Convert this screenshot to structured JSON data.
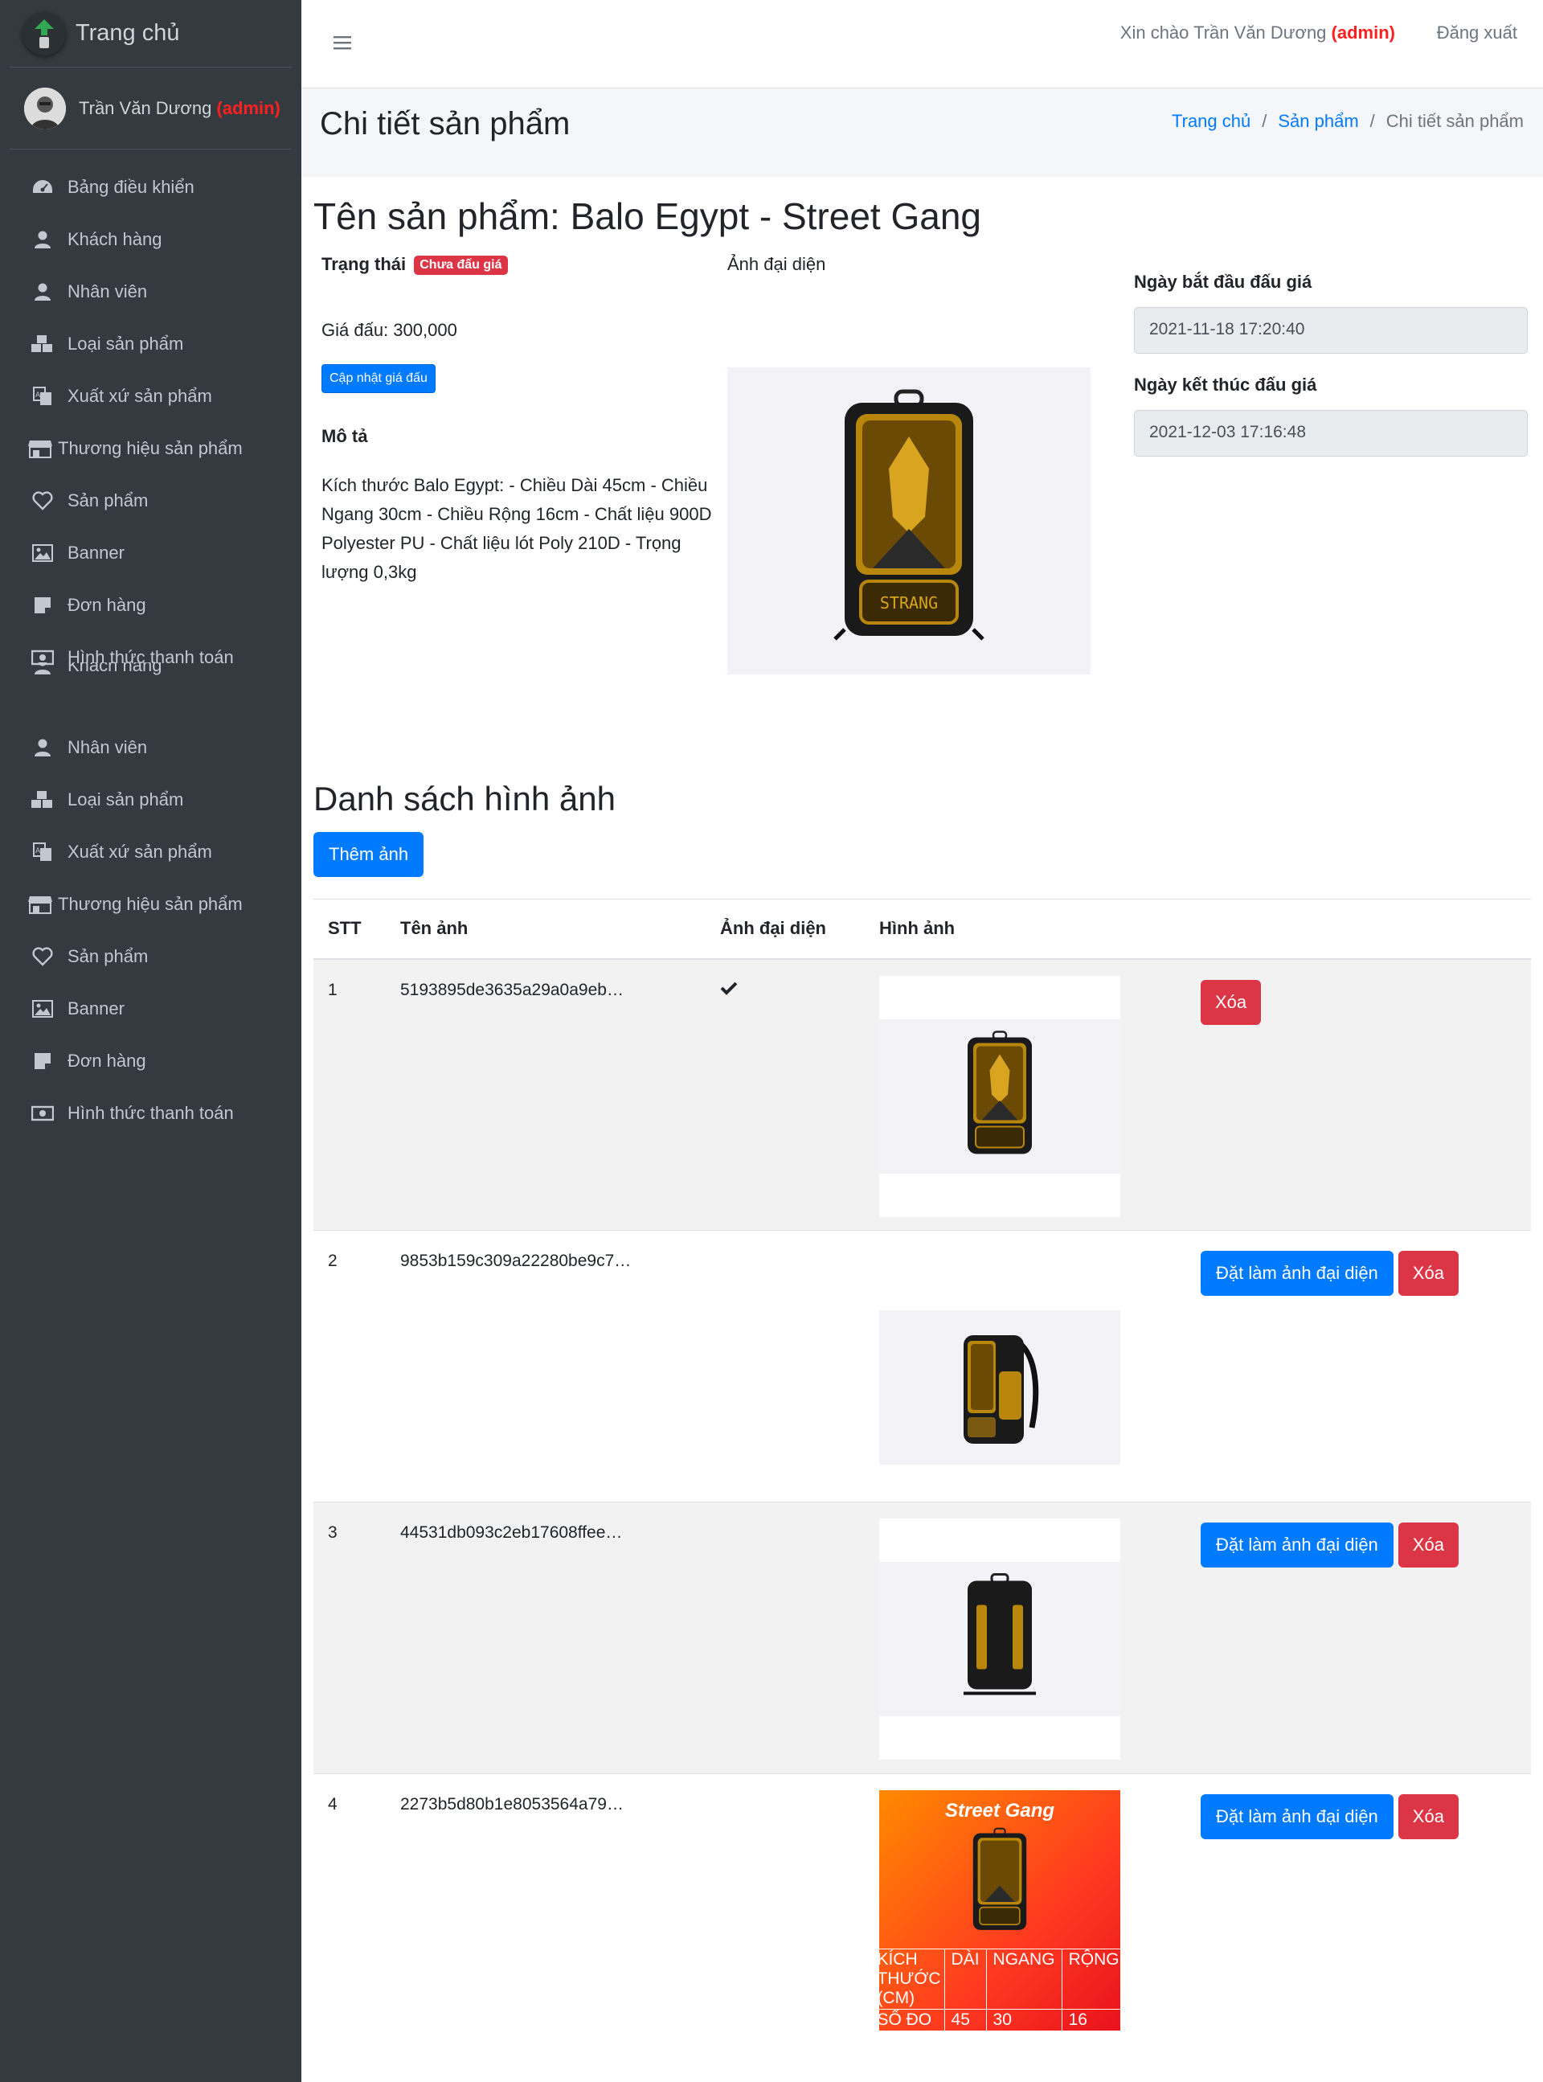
{
  "brand": {
    "title": "Trang chủ"
  },
  "user": {
    "name": "Trần Văn Dương",
    "role": "(admin)"
  },
  "sidebar": {
    "items": [
      {
        "label": "Bảng điều khiển",
        "icon": "dashboard-icon"
      },
      {
        "label": "Khách hàng",
        "icon": "user-icon"
      },
      {
        "label": "Nhân viên",
        "icon": "user-icon"
      },
      {
        "label": "Loại sản phẩm",
        "icon": "cubes-icon"
      },
      {
        "label": "Xuất xứ sản phẩm",
        "icon": "language-icon"
      },
      {
        "label": "Thương hiệu sản phẩm",
        "icon": "store-icon"
      },
      {
        "label": "Sản phẩm",
        "icon": "heart-icon"
      },
      {
        "label": "Banner",
        "icon": "image-icon"
      },
      {
        "label": "Đơn hàng",
        "icon": "note-icon"
      },
      {
        "label": "Hình thức thanh toán",
        "icon": "money-icon"
      }
    ],
    "items2": [
      {
        "label": "Khách hàng",
        "icon": "user-icon"
      },
      {
        "label": "Nhân viên",
        "icon": "user-icon"
      },
      {
        "label": "Loại sản phẩm",
        "icon": "cubes-icon"
      },
      {
        "label": "Xuất xứ sản phẩm",
        "icon": "language-icon"
      },
      {
        "label": "Thương hiệu sản phẩm",
        "icon": "store-icon"
      },
      {
        "label": "Sản phẩm",
        "icon": "heart-icon"
      },
      {
        "label": "Banner",
        "icon": "image-icon"
      },
      {
        "label": "Đơn hàng",
        "icon": "note-icon"
      },
      {
        "label": "Hình thức thanh toán",
        "icon": "money-icon"
      }
    ]
  },
  "header": {
    "greeting": "Xin chào Trần Văn Dương",
    "role": "(admin)",
    "logout": "Đăng xuất"
  },
  "page": {
    "title": "Chi tiết sản phẩm",
    "breadcrumb": [
      "Trang chủ",
      "Sản phẩm",
      "Chi tiết sản phẩm"
    ]
  },
  "product": {
    "title": "Tên sản phẩm: Balo Egypt - Street Gang",
    "status_label": "Trạng thái",
    "status_badge": "Chưa đấu giá",
    "start_price": "Giá đấu: 300,000",
    "update_price_button": "Cập nhật giá đấu",
    "description_label": "Mô tả",
    "description": "Kích thước Balo Egypt: - Chiều Dài 45cm - Chiều Ngang 30cm - Chiều Rộng 16cm - Chất liệu 900D Polyester PU - Chất liệu lót Poly 210D - Trọng lượng 0,3kg",
    "avatar_label": "Ảnh đại diện",
    "start_date_label": "Ngày bắt đầu đấu giá",
    "start_date": "2021-11-18 17:20:40",
    "end_date_label": "Ngày kết thúc đấu giá",
    "end_date": "2021-12-03 17:16:48"
  },
  "gallery": {
    "title": "Danh sách hình ảnh",
    "add_button": "Thêm ảnh",
    "columns": [
      "STT",
      "Tên ảnh",
      "Ảnh đại diện",
      "Hình ảnh"
    ],
    "set_avatar_label": "Đặt làm ảnh đại diện",
    "delete_label": "Xóa",
    "rows": [
      {
        "stt": "1",
        "name": "5193895de3635a29a0a9eb…",
        "is_avatar": true
      },
      {
        "stt": "2",
        "name": "9853b159c309a22280be9c7…",
        "is_avatar": false
      },
      {
        "stt": "3",
        "name": "44531db093c2eb17608ffee…",
        "is_avatar": false
      },
      {
        "stt": "4",
        "name": "2273b5d80b1e8053564a79…",
        "is_avatar": false
      }
    ],
    "poster": {
      "brand": "Street Gang",
      "size_table": [
        [
          "KÍCH THƯỚC (CM)",
          "DÀI",
          "NGANG",
          "RỘNG"
        ],
        [
          "SỐ ĐO",
          "45",
          "30",
          "16"
        ]
      ]
    }
  },
  "colors": {
    "sidebar": "#343a40",
    "primary": "#007bff",
    "danger": "#dc3545",
    "admin": "#ff2020"
  }
}
